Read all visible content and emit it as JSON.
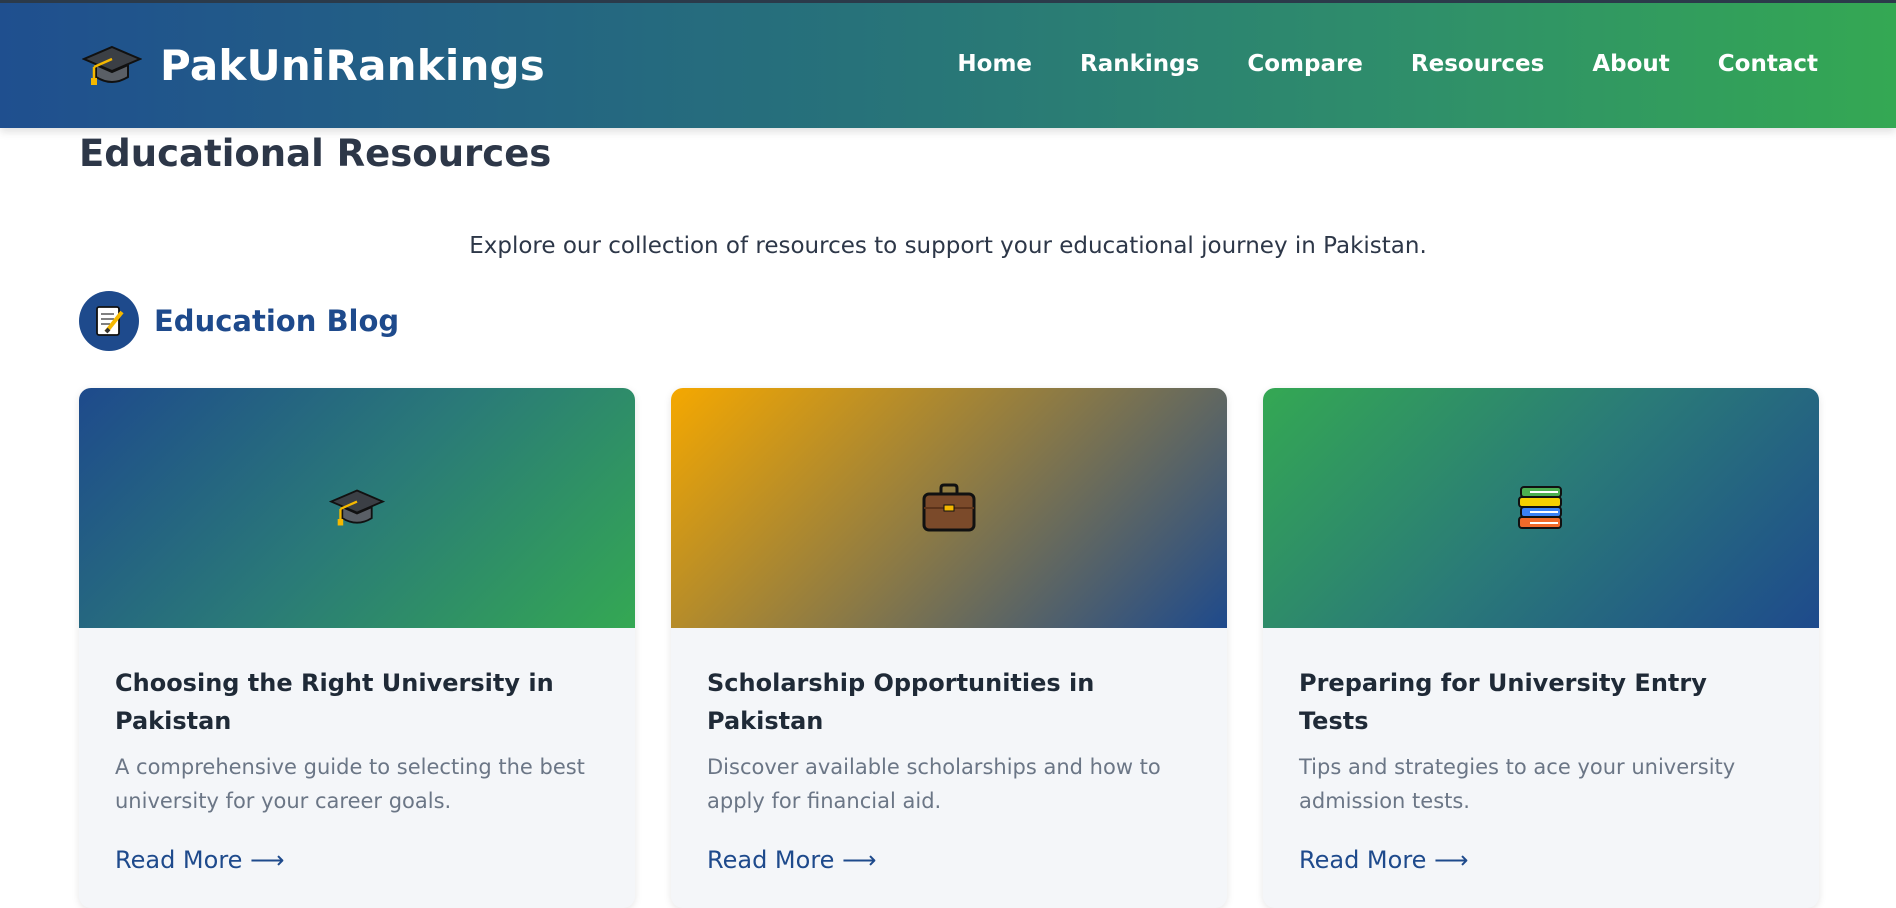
{
  "header": {
    "logo_text": "PakUniRankings",
    "logo_icon": "graduation-cap-icon",
    "nav": [
      {
        "label": "Home"
      },
      {
        "label": "Rankings"
      },
      {
        "label": "Compare"
      },
      {
        "label": "Resources"
      },
      {
        "label": "About"
      },
      {
        "label": "Contact"
      }
    ]
  },
  "main": {
    "title": "Educational Resources",
    "intro": "Explore our collection of resources to support your educational journey in Pakistan.",
    "section": {
      "icon": "memo-icon",
      "title": "Education Blog"
    },
    "cards": [
      {
        "icon": "graduation-cap-icon",
        "title": "Choosing the Right University in Pakistan",
        "description": "A comprehensive guide to selecting the best university for your career goals.",
        "link": "Read More ⟶"
      },
      {
        "icon": "briefcase-icon",
        "title": "Scholarship Opportunities in Pakistan",
        "description": "Discover available scholarships and how to apply for financial aid.",
        "link": "Read More ⟶"
      },
      {
        "icon": "books-icon",
        "title": "Preparing for University Entry Tests",
        "description": "Tips and strategies to ace your university admission tests.",
        "link": "Read More ⟶"
      }
    ]
  },
  "colors": {
    "brand_blue": "#1e4a8c",
    "brand_green": "#34a853",
    "accent_gold": "#f5a800"
  }
}
